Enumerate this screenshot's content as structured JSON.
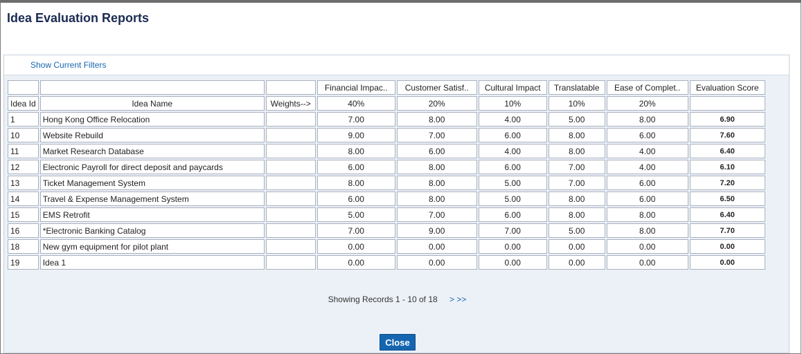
{
  "window": {
    "title": "Idea Evaluation Reports"
  },
  "filters": {
    "link_label": "Show Current Filters"
  },
  "table": {
    "criteria_headers": [
      "Financial Impac..",
      "Customer Satisf..",
      "Cultural Impact",
      "Translatable",
      "Ease of Complet..",
      "Evaluation Score"
    ],
    "id_header": "Idea Id",
    "name_header": "Idea Name",
    "weights_label": "Weights-->",
    "weights": [
      "40%",
      "20%",
      "10%",
      "10%",
      "20%"
    ],
    "rows": [
      {
        "id": "1",
        "name": "Hong Kong Office Relocation",
        "scores": [
          "7.00",
          "8.00",
          "4.00",
          "5.00",
          "8.00"
        ],
        "evaluation": "6.90"
      },
      {
        "id": "10",
        "name": "Website Rebuild",
        "scores": [
          "9.00",
          "7.00",
          "6.00",
          "8.00",
          "6.00"
        ],
        "evaluation": "7.60"
      },
      {
        "id": "11",
        "name": "Market Research Database",
        "scores": [
          "8.00",
          "6.00",
          "4.00",
          "8.00",
          "4.00"
        ],
        "evaluation": "6.40"
      },
      {
        "id": "12",
        "name": "Electronic Payroll for direct deposit and paycards",
        "scores": [
          "6.00",
          "8.00",
          "6.00",
          "7.00",
          "4.00"
        ],
        "evaluation": "6.10"
      },
      {
        "id": "13",
        "name": "Ticket Management System",
        "scores": [
          "8.00",
          "8.00",
          "5.00",
          "7.00",
          "6.00"
        ],
        "evaluation": "7.20"
      },
      {
        "id": "14",
        "name": "Travel & Expense Management System",
        "scores": [
          "6.00",
          "8.00",
          "5.00",
          "8.00",
          "6.00"
        ],
        "evaluation": "6.50"
      },
      {
        "id": "15",
        "name": "EMS Retrofit",
        "scores": [
          "5.00",
          "7.00",
          "6.00",
          "8.00",
          "8.00"
        ],
        "evaluation": "6.40"
      },
      {
        "id": "16",
        "name": "*Electronic Banking Catalog",
        "scores": [
          "7.00",
          "9.00",
          "7.00",
          "5.00",
          "8.00"
        ],
        "evaluation": "7.70"
      },
      {
        "id": "18",
        "name": "New gym equipment for pilot plant",
        "scores": [
          "0.00",
          "0.00",
          "0.00",
          "0.00",
          "0.00"
        ],
        "evaluation": "0.00"
      },
      {
        "id": "19",
        "name": "Idea 1",
        "scores": [
          "0.00",
          "0.00",
          "0.00",
          "0.00",
          "0.00"
        ],
        "evaluation": "0.00"
      }
    ]
  },
  "pager": {
    "status": "Showing Records 1 - 10 of 18",
    "next_label": "> >>"
  },
  "footer": {
    "close_label": "Close"
  },
  "colors": {
    "title": "#1a2a52",
    "link": "#1566b0",
    "button": "#1565b0",
    "panel": "#ecf1f8"
  }
}
